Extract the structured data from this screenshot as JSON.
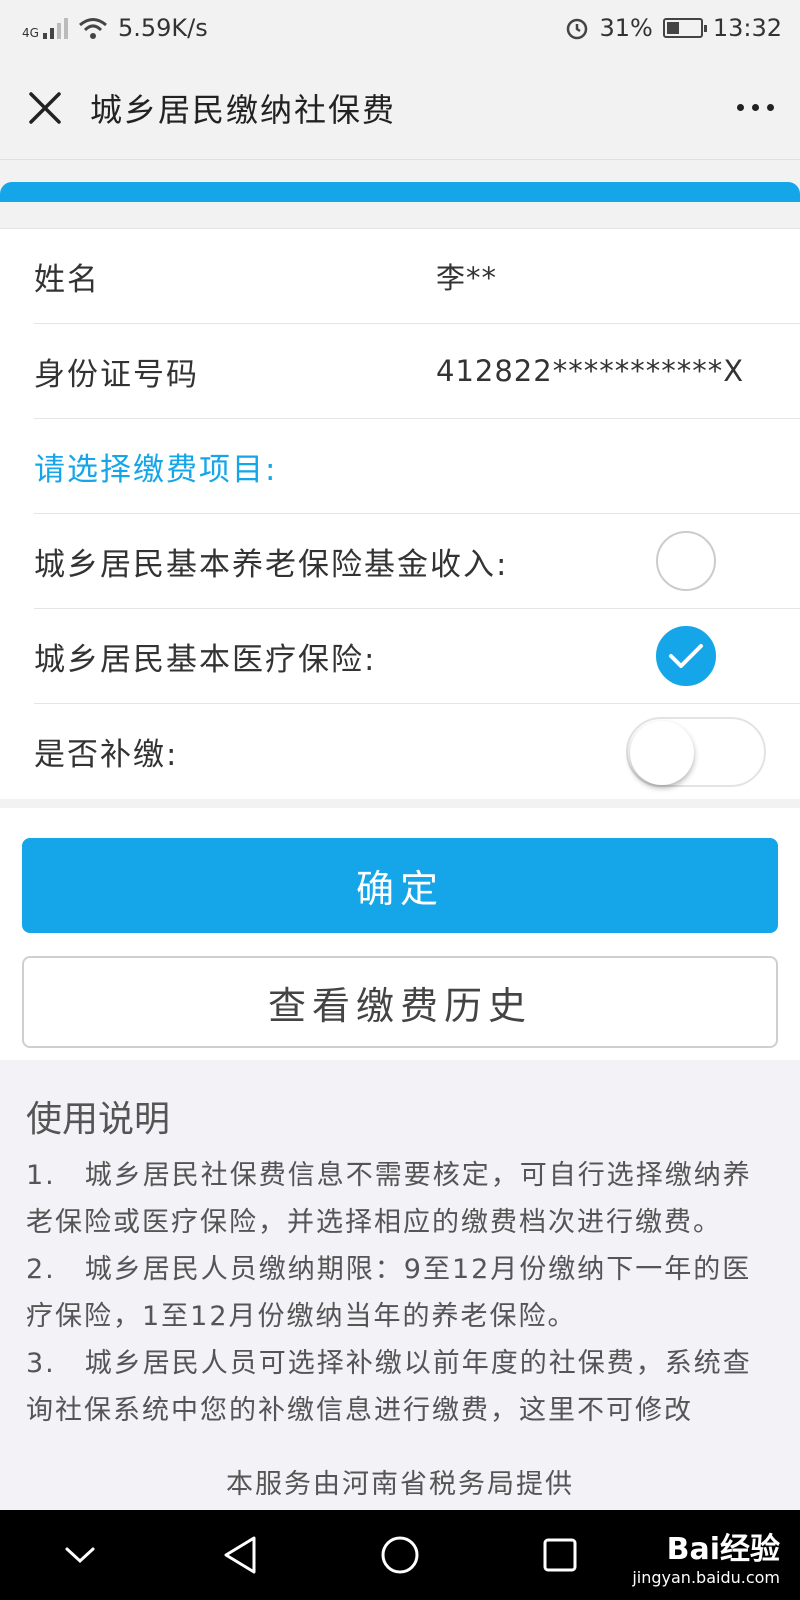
{
  "status_bar": {
    "network": "4G",
    "speed": "5.59K/s",
    "battery": "31%",
    "time": "13:32"
  },
  "header": {
    "title": "城乡居民缴纳社保费"
  },
  "form": {
    "name_label": "姓名",
    "name_value": "李**",
    "id_label": "身份证号码",
    "id_value": "412822***********X",
    "section_title": "请选择缴费项目:",
    "options": [
      {
        "label": "城乡居民基本养老保险基金收入:",
        "checked": false
      },
      {
        "label": "城乡居民基本医疗保险:",
        "checked": true
      }
    ],
    "backpay_label": "是否补缴:",
    "backpay_on": false
  },
  "buttons": {
    "confirm": "确定",
    "history": "查看缴费历史"
  },
  "instructions": {
    "title": "使用说明",
    "items": [
      "1.　城乡居民社保费信息不需要核定，可自行选择缴纳养老保险或医疗保险，并选择相应的缴费档次进行缴费。",
      "2.　城乡居民人员缴纳期限：9至12月份缴纳下一年的医疗保险，1至12月份缴纳当年的养老保险。",
      "3.　城乡居民人员可选择补缴以前年度的社保费，系统查询社保系统中您的补缴信息进行缴费，这里不可修改"
    ]
  },
  "footer_note": "本服务由河南省税务局提供",
  "watermark": {
    "brand": "Bai经验",
    "url": "jingyan.baidu.com"
  },
  "colors": {
    "accent": "#14a6e8"
  }
}
